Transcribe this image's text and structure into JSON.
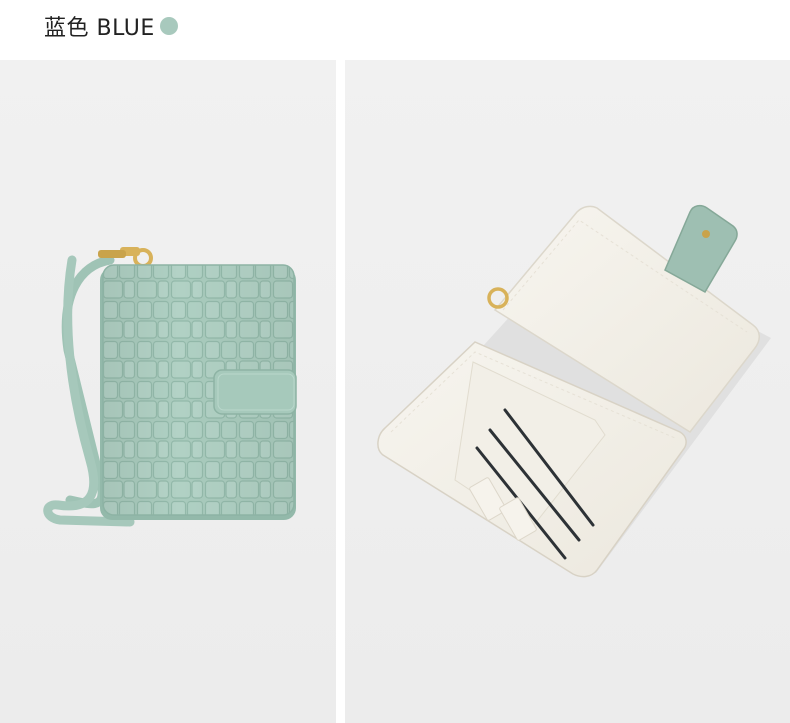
{
  "header": {
    "color_label": "蓝色 BLUE",
    "swatch_color": "#a8c9bd"
  },
  "colors": {
    "wallet_green": "#a9cbbd",
    "wallet_green_dark": "#8fb6a7",
    "interior_cream": "#f4f1ea",
    "hardware_gold": "#d8b25a"
  },
  "images": [
    {
      "name": "wallet-closed-photo"
    },
    {
      "name": "wallet-open-photo"
    }
  ]
}
